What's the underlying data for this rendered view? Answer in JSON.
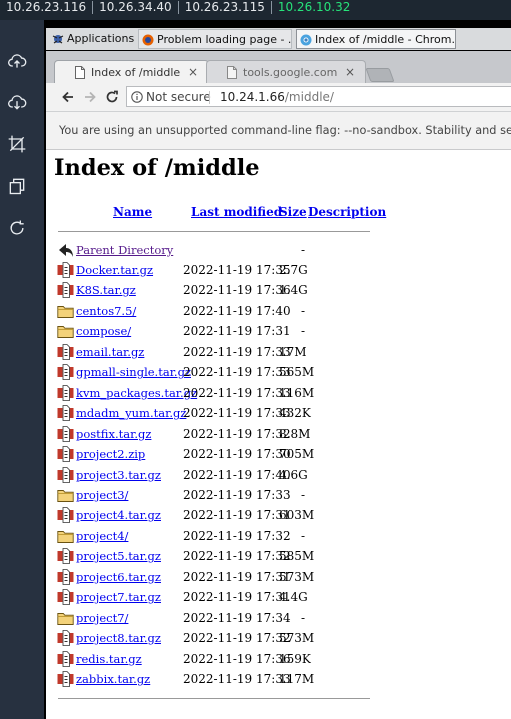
{
  "hosts": [
    {
      "ip": "10.26.23.116",
      "active": false
    },
    {
      "ip": "10.26.34.40",
      "active": false
    },
    {
      "ip": "10.26.23.115",
      "active": false
    },
    {
      "ip": "10.26.10.32",
      "active": true
    }
  ],
  "left_tools": [
    {
      "name": "cloud-upload-icon"
    },
    {
      "name": "cloud-download-icon"
    },
    {
      "name": "crop-icon"
    },
    {
      "name": "copy-windows-icon"
    },
    {
      "name": "refresh-icon"
    }
  ],
  "taskbar": {
    "applications": "Applications",
    "task2": "Problem loading page - ...",
    "task3": "Index of /middle - Chrom..."
  },
  "tabs": [
    {
      "title": "Index of /middle",
      "close": "×"
    },
    {
      "title": "tools.google.com",
      "close": "×"
    }
  ],
  "omnibox": {
    "security": "Not secure",
    "host": "10.24.1.66",
    "path": "/middle/"
  },
  "infobar": "You are using an unsupported command-line flag: --no-sandbox. Stability and sec",
  "page": {
    "title": "Index of /middle",
    "headers": {
      "name": "Name",
      "modified": "Last modified",
      "size": "Size",
      "description": "Description"
    },
    "parent": {
      "name": "Parent Directory",
      "size": "-"
    },
    "entries": [
      {
        "name": "Docker.tar.gz",
        "modified": "2022-11-19 17:35",
        "size": "2.7G",
        "type": "file"
      },
      {
        "name": "K8S.tar.gz",
        "modified": "2022-11-19 17:36",
        "size": "1.4G",
        "type": "file"
      },
      {
        "name": "centos7.5/",
        "modified": "2022-11-19 17:40",
        "size": "-",
        "type": "folder"
      },
      {
        "name": "compose/",
        "modified": "2022-11-19 17:31",
        "size": "-",
        "type": "folder"
      },
      {
        "name": "email.tar.gz",
        "modified": "2022-11-19 17:33",
        "size": "17M",
        "type": "file"
      },
      {
        "name": "gpmall-single.tar.gz",
        "modified": "2022-11-19 17:33",
        "size": "565M",
        "type": "file"
      },
      {
        "name": "kvm_packages.tar.gz",
        "modified": "2022-11-19 17:33",
        "size": "116M",
        "type": "file"
      },
      {
        "name": "mdadm_yum.tar.gz",
        "modified": "2022-11-19 17:33",
        "size": "432K",
        "type": "file"
      },
      {
        "name": "postfix.tar.gz",
        "modified": "2022-11-19 17:32",
        "size": "8.8M",
        "type": "file"
      },
      {
        "name": "project2.zip",
        "modified": "2022-11-19 17:30",
        "size": "705M",
        "type": "file"
      },
      {
        "name": "project3.tar.gz",
        "modified": "2022-11-19 17:40",
        "size": "4.6G",
        "type": "file"
      },
      {
        "name": "project3/",
        "modified": "2022-11-19 17:33",
        "size": "-",
        "type": "folder"
      },
      {
        "name": "project4.tar.gz",
        "modified": "2022-11-19 17:31",
        "size": "603M",
        "type": "file"
      },
      {
        "name": "project4/",
        "modified": "2022-11-19 17:32",
        "size": "-",
        "type": "folder"
      },
      {
        "name": "project5.tar.gz",
        "modified": "2022-11-19 17:32",
        "size": "585M",
        "type": "file"
      },
      {
        "name": "project6.tar.gz",
        "modified": "2022-11-19 17:31",
        "size": "573M",
        "type": "file"
      },
      {
        "name": "project7.tar.gz",
        "modified": "2022-11-19 17:31",
        "size": "4.4G",
        "type": "file"
      },
      {
        "name": "project7/",
        "modified": "2022-11-19 17:34",
        "size": "-",
        "type": "folder"
      },
      {
        "name": "project8.tar.gz",
        "modified": "2022-11-19 17:32",
        "size": "573M",
        "type": "file"
      },
      {
        "name": "redis.tar.gz",
        "modified": "2022-11-19 17:36",
        "size": "159K",
        "type": "file"
      },
      {
        "name": "zabbix.tar.gz",
        "modified": "2022-11-19 17:33",
        "size": "117M",
        "type": "file"
      }
    ]
  },
  "colors": {
    "active_host": "#27e37a",
    "link": "#0000ee",
    "visited": "#551a8b",
    "folder": "#f3d27a",
    "archive": "#c0392b"
  }
}
